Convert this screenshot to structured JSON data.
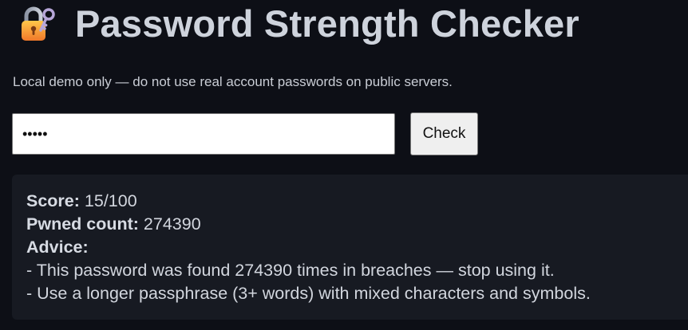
{
  "header": {
    "icon": "locked-with-key-icon",
    "title": "Password Strength Checker"
  },
  "notice": "Local demo only — do not use real account passwords on public servers.",
  "form": {
    "password_value": "•••••",
    "check_label": "Check"
  },
  "result": {
    "score_label": "Score:",
    "score_value": "15/100",
    "pwned_label": "Pwned count:",
    "pwned_value": "274390",
    "advice_label": "Advice:",
    "advice": [
      "- This password was found 274390 times in breaches — stop using it.",
      "- Use a longer passphrase (3+ words) with mixed characters and symbols."
    ]
  }
}
